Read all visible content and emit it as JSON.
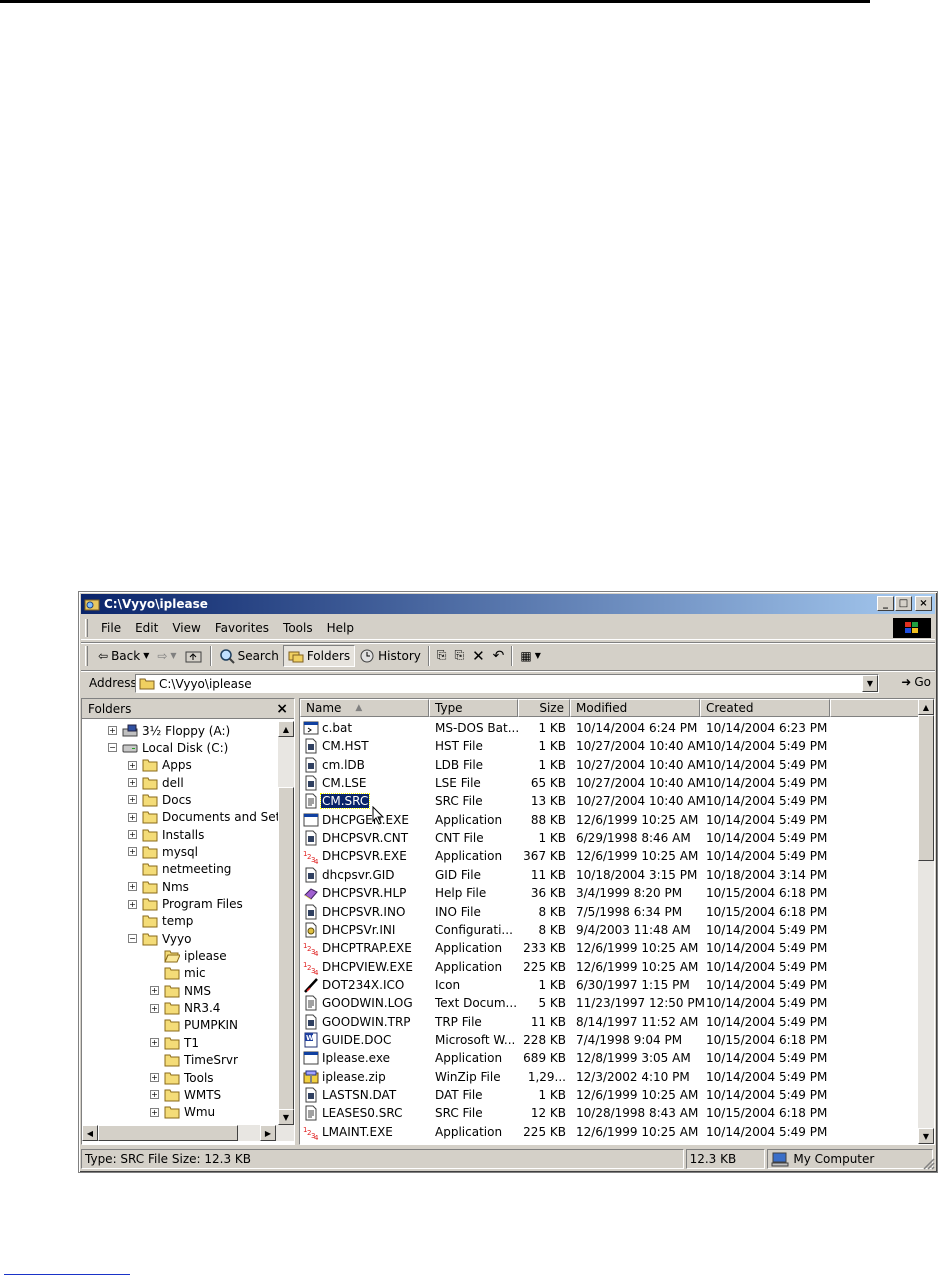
{
  "window": {
    "title": "C:\\Vyyo\\iplease"
  },
  "menu": [
    "File",
    "Edit",
    "View",
    "Favorites",
    "Tools",
    "Help"
  ],
  "toolbar": {
    "back": "Back",
    "search": "Search",
    "folders": "Folders",
    "history": "History"
  },
  "address": {
    "label": "Address",
    "path": "C:\\Vyyo\\iplease",
    "go": "Go"
  },
  "folders_pane": {
    "title": "Folders",
    "close": "×"
  },
  "tree": [
    {
      "label": "3½ Floppy (A:)",
      "icon": "floppy-drive-icon",
      "pm": "+"
    },
    {
      "label": "Local Disk (C:)",
      "icon": "hard-disk-icon",
      "pm": "−"
    },
    {
      "label": "Apps",
      "icon": "folder-icon",
      "pm": "+"
    },
    {
      "label": "dell",
      "icon": "folder-icon",
      "pm": "+"
    },
    {
      "label": "Docs",
      "icon": "folder-icon",
      "pm": "+"
    },
    {
      "label": "Documents and Settin",
      "icon": "folder-icon",
      "pm": "+"
    },
    {
      "label": "Installs",
      "icon": "folder-icon",
      "pm": "+"
    },
    {
      "label": "mysql",
      "icon": "folder-icon",
      "pm": "+"
    },
    {
      "label": "netmeeting",
      "icon": "folder-icon",
      "pm": ""
    },
    {
      "label": "Nms",
      "icon": "folder-icon",
      "pm": "+"
    },
    {
      "label": "Program Files",
      "icon": "folder-icon",
      "pm": "+"
    },
    {
      "label": "temp",
      "icon": "folder-icon",
      "pm": ""
    },
    {
      "label": "Vyyo",
      "icon": "folder-icon",
      "pm": "−"
    },
    {
      "label": "iplease",
      "icon": "open-folder-icon",
      "pm": ""
    },
    {
      "label": "mic",
      "icon": "folder-icon",
      "pm": ""
    },
    {
      "label": "NMS",
      "icon": "folder-icon",
      "pm": "+"
    },
    {
      "label": "NR3.4",
      "icon": "folder-icon",
      "pm": "+"
    },
    {
      "label": "PUMPKIN",
      "icon": "folder-icon",
      "pm": ""
    },
    {
      "label": "T1",
      "icon": "folder-icon",
      "pm": "+"
    },
    {
      "label": "TimeSrvr",
      "icon": "folder-icon",
      "pm": ""
    },
    {
      "label": "Tools",
      "icon": "folder-icon",
      "pm": "+"
    },
    {
      "label": "WMTS",
      "icon": "folder-icon",
      "pm": "+"
    },
    {
      "label": "Wmu",
      "icon": "folder-icon",
      "pm": "+"
    }
  ],
  "columns": {
    "name": "Name",
    "type": "Type",
    "size": "Size",
    "modified": "Modified",
    "created": "Created",
    "sort_arrow": "▲"
  },
  "files": [
    {
      "name": "c.bat",
      "type": "MS-DOS Bat...",
      "size": "1 KB",
      "modified": "10/14/2004 6:24 PM",
      "created": "10/14/2004 6:23 PM",
      "icon": "batch-file-icon"
    },
    {
      "name": "CM.HST",
      "type": "HST File",
      "size": "1 KB",
      "modified": "10/27/2004 10:40 AM",
      "created": "10/14/2004 5:49 PM",
      "icon": "generic-file-icon"
    },
    {
      "name": "cm.lDB",
      "type": "LDB File",
      "size": "1 KB",
      "modified": "10/27/2004 10:40 AM",
      "created": "10/14/2004 5:49 PM",
      "icon": "generic-file-icon"
    },
    {
      "name": "CM.LSE",
      "type": "LSE File",
      "size": "65 KB",
      "modified": "10/27/2004 10:40 AM",
      "created": "10/14/2004 5:49 PM",
      "icon": "generic-file-icon"
    },
    {
      "name": "CM.SRC",
      "type": "SRC File",
      "size": "13 KB",
      "modified": "10/27/2004 10:40 AM",
      "created": "10/14/2004 5:49 PM",
      "icon": "text-file-icon"
    },
    {
      "name": "DHCPGEN.EXE",
      "type": "Application",
      "size": "88 KB",
      "modified": "12/6/1999 10:25 AM",
      "created": "10/14/2004 5:49 PM",
      "icon": "application-icon"
    },
    {
      "name": "DHCPSVR.CNT",
      "type": "CNT File",
      "size": "1 KB",
      "modified": "6/29/1998 8:46 AM",
      "created": "10/14/2004 5:49 PM",
      "icon": "generic-file-icon"
    },
    {
      "name": "DHCPSVR.EXE",
      "type": "Application",
      "size": "367 KB",
      "modified": "12/6/1999 10:25 AM",
      "created": "10/14/2004 5:49 PM",
      "icon": "dhcp-app-icon"
    },
    {
      "name": "dhcpsvr.GID",
      "type": "GID File",
      "size": "11 KB",
      "modified": "10/18/2004 3:15 PM",
      "created": "10/18/2004 3:14 PM",
      "icon": "generic-file-icon"
    },
    {
      "name": "DHCPSVR.HLP",
      "type": "Help File",
      "size": "36 KB",
      "modified": "3/4/1999 8:20 PM",
      "created": "10/15/2004 6:18 PM",
      "icon": "help-book-icon"
    },
    {
      "name": "DHCPSVR.INO",
      "type": "INO File",
      "size": "8 KB",
      "modified": "7/5/1998 6:34 PM",
      "created": "10/15/2004 6:18 PM",
      "icon": "generic-file-icon"
    },
    {
      "name": "DHCPSVr.INI",
      "type": "Configurati...",
      "size": "8 KB",
      "modified": "9/4/2003 11:48 AM",
      "created": "10/14/2004 5:49 PM",
      "icon": "config-file-icon"
    },
    {
      "name": "DHCPTRAP.EXE",
      "type": "Application",
      "size": "233 KB",
      "modified": "12/6/1999 10:25 AM",
      "created": "10/14/2004 5:49 PM",
      "icon": "dhcp-app-icon"
    },
    {
      "name": "DHCPVIEW.EXE",
      "type": "Application",
      "size": "225 KB",
      "modified": "12/6/1999 10:25 AM",
      "created": "10/14/2004 5:49 PM",
      "icon": "dhcp-app-icon"
    },
    {
      "name": "DOT234X.ICO",
      "type": "Icon",
      "size": "1 KB",
      "modified": "6/30/1997 1:15 PM",
      "created": "10/14/2004 5:49 PM",
      "icon": "icon-file-icon"
    },
    {
      "name": "GOODWIN.LOG",
      "type": "Text Docum...",
      "size": "5 KB",
      "modified": "11/23/1997 12:50 PM",
      "created": "10/14/2004 5:49 PM",
      "icon": "text-file-icon"
    },
    {
      "name": "GOODWIN.TRP",
      "type": "TRP File",
      "size": "11 KB",
      "modified": "8/14/1997 11:52 AM",
      "created": "10/14/2004 5:49 PM",
      "icon": "generic-file-icon"
    },
    {
      "name": "GUIDE.DOC",
      "type": "Microsoft W...",
      "size": "228 KB",
      "modified": "7/4/1998 9:04 PM",
      "created": "10/15/2004 6:18 PM",
      "icon": "word-doc-icon"
    },
    {
      "name": "Iplease.exe",
      "type": "Application",
      "size": "689 KB",
      "modified": "12/8/1999 3:05 AM",
      "created": "10/14/2004 5:49 PM",
      "icon": "application-icon"
    },
    {
      "name": "iplease.zip",
      "type": "WinZip File",
      "size": "1,29...",
      "modified": "12/3/2002 4:10 PM",
      "created": "10/14/2004 5:49 PM",
      "icon": "zip-file-icon"
    },
    {
      "name": "LASTSN.DAT",
      "type": "DAT File",
      "size": "1 KB",
      "modified": "12/6/1999 10:25 AM",
      "created": "10/14/2004 5:49 PM",
      "icon": "generic-file-icon"
    },
    {
      "name": "LEASES0.SRC",
      "type": "SRC File",
      "size": "12 KB",
      "modified": "10/28/1998 8:43 AM",
      "created": "10/15/2004 6:18 PM",
      "icon": "text-file-icon"
    },
    {
      "name": "LMAINT.EXE",
      "type": "Application",
      "size": "225 KB",
      "modified": "12/6/1999 10:25 AM",
      "created": "10/14/2004 5:49 PM",
      "icon": "dhcp-app-icon"
    }
  ],
  "selected_file": "CM.SRC",
  "status": {
    "info": "Type: SRC File Size: 12.3 KB",
    "size": "12.3 KB",
    "zone": "My Computer"
  }
}
